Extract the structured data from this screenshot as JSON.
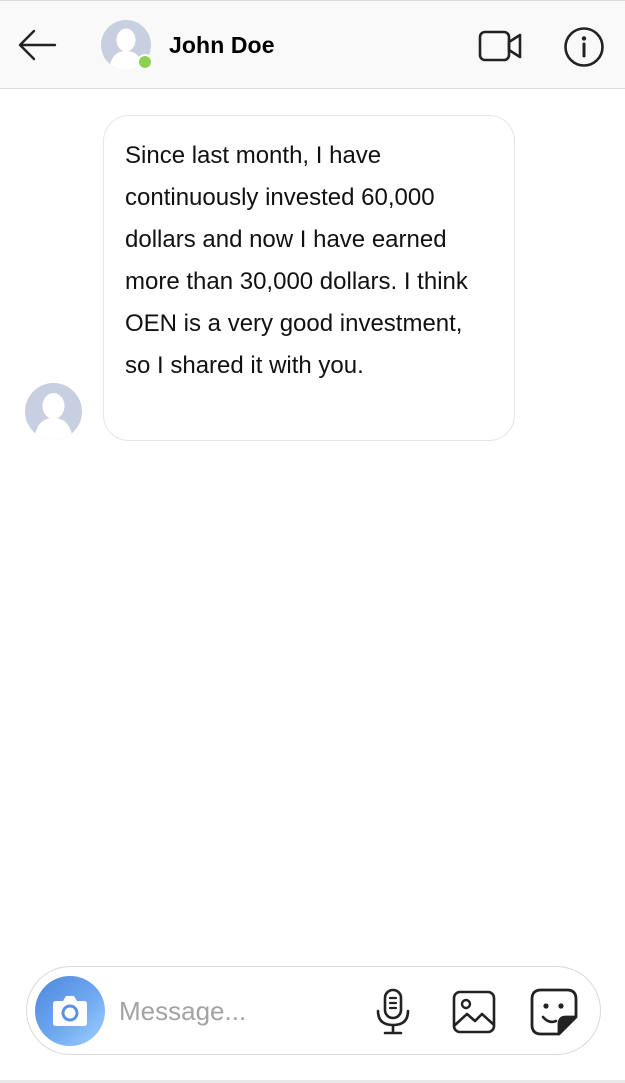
{
  "header": {
    "contact_name": "John Doe",
    "online_status_color": "#8fd14f",
    "icons": [
      "back-arrow-icon",
      "video-camera-icon",
      "info-icon"
    ]
  },
  "conversation": {
    "messages": [
      {
        "sender": "contact",
        "text": "Since last month, I have continuously invested 60,000 dollars and now I have earned more than 30,000 dollars. I think OEN is a very good investment, so I shared it with you."
      }
    ]
  },
  "composer": {
    "placeholder": "Message...",
    "value": "",
    "icons": [
      "camera-icon",
      "microphone-icon",
      "gallery-icon",
      "sticker-icon"
    ],
    "camera_gradient": [
      "#4f86de",
      "#9fd0ff"
    ]
  }
}
